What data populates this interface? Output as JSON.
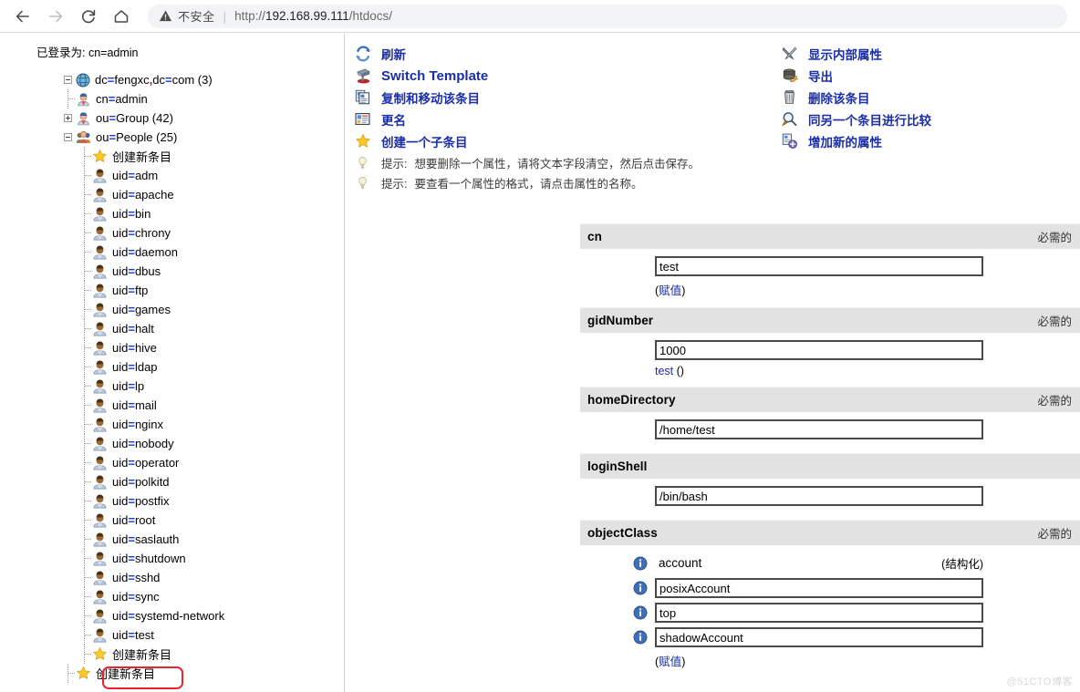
{
  "browser": {
    "back_icon": "back-arrow-icon",
    "forward_icon": "forward-arrow-icon",
    "reload_icon": "reload-icon",
    "home_icon": "home-icon",
    "warning_icon": "warning-triangle-icon",
    "insecure_label": "不安全",
    "separator": "|",
    "url_scheme": "http://",
    "url_host": "192.168.99.111",
    "url_path": "/htdocs/"
  },
  "sidebar": {
    "login_status": "已登录为: cn=admin",
    "tree": [
      {
        "label_pre": "dc",
        "label_mid": "fengxc",
        "label_post": "dc",
        "label_tail": "com",
        "count": "(3)",
        "icon": "globe-icon",
        "expander": "minus",
        "depth": 0,
        "type": "root"
      },
      {
        "label": "cn=admin",
        "icon": "user-admin-icon",
        "depth": 1,
        "type": "entry"
      },
      {
        "label": "ou=Group",
        "count": "(42)",
        "icon": "user-admin-icon",
        "expander": "plus",
        "depth": 1,
        "type": "entry"
      },
      {
        "label": "ou=People",
        "count": "(25)",
        "icon": "group-icon",
        "expander": "minus",
        "depth": 1,
        "type": "entry"
      },
      {
        "label": "创建新条目",
        "icon": "star-icon",
        "depth": 2,
        "type": "new"
      },
      {
        "label": "uid=adm",
        "icon": "person-icon",
        "depth": 2,
        "type": "entry"
      },
      {
        "label": "uid=apache",
        "icon": "person-icon",
        "depth": 2,
        "type": "entry"
      },
      {
        "label": "uid=bin",
        "icon": "person-icon",
        "depth": 2,
        "type": "entry"
      },
      {
        "label": "uid=chrony",
        "icon": "person-icon",
        "depth": 2,
        "type": "entry"
      },
      {
        "label": "uid=daemon",
        "icon": "person-icon",
        "depth": 2,
        "type": "entry"
      },
      {
        "label": "uid=dbus",
        "icon": "person-icon",
        "depth": 2,
        "type": "entry"
      },
      {
        "label": "uid=ftp",
        "icon": "person-icon",
        "depth": 2,
        "type": "entry"
      },
      {
        "label": "uid=games",
        "icon": "person-icon",
        "depth": 2,
        "type": "entry"
      },
      {
        "label": "uid=halt",
        "icon": "person-icon",
        "depth": 2,
        "type": "entry"
      },
      {
        "label": "uid=hive",
        "icon": "person-icon",
        "depth": 2,
        "type": "entry"
      },
      {
        "label": "uid=ldap",
        "icon": "person-icon",
        "depth": 2,
        "type": "entry"
      },
      {
        "label": "uid=lp",
        "icon": "person-icon",
        "depth": 2,
        "type": "entry"
      },
      {
        "label": "uid=mail",
        "icon": "person-icon",
        "depth": 2,
        "type": "entry"
      },
      {
        "label": "uid=nginx",
        "icon": "person-icon",
        "depth": 2,
        "type": "entry"
      },
      {
        "label": "uid=nobody",
        "icon": "person-icon",
        "depth": 2,
        "type": "entry"
      },
      {
        "label": "uid=operator",
        "icon": "person-icon",
        "depth": 2,
        "type": "entry"
      },
      {
        "label": "uid=polkitd",
        "icon": "person-icon",
        "depth": 2,
        "type": "entry"
      },
      {
        "label": "uid=postfix",
        "icon": "person-icon",
        "depth": 2,
        "type": "entry"
      },
      {
        "label": "uid=root",
        "icon": "person-icon",
        "depth": 2,
        "type": "entry"
      },
      {
        "label": "uid=saslauth",
        "icon": "person-icon",
        "depth": 2,
        "type": "entry"
      },
      {
        "label": "uid=shutdown",
        "icon": "person-icon",
        "depth": 2,
        "type": "entry"
      },
      {
        "label": "uid=sshd",
        "icon": "person-icon",
        "depth": 2,
        "type": "entry"
      },
      {
        "label": "uid=sync",
        "icon": "person-icon",
        "depth": 2,
        "type": "entry"
      },
      {
        "label": "uid=systemd-network",
        "icon": "person-icon",
        "depth": 2,
        "type": "entry"
      },
      {
        "label": "uid=test",
        "icon": "person-icon",
        "depth": 2,
        "type": "entry",
        "selected": true
      },
      {
        "label": "创建新条目",
        "icon": "star-icon",
        "depth": 2,
        "type": "new"
      },
      {
        "label": "创建新条目",
        "icon": "star-icon",
        "depth": 1,
        "type": "new"
      }
    ],
    "highlight_color": "#e8252a"
  },
  "toolbar": {
    "left": [
      {
        "label": "刷新",
        "icon": "refresh-icon"
      },
      {
        "label": "Switch Template",
        "icon": "template-icon",
        "big": true
      },
      {
        "label": "复制和移动该条目",
        "icon": "copy-icon"
      },
      {
        "label": "更名",
        "icon": "rename-icon"
      },
      {
        "label": "创建一个子条目",
        "icon": "star-icon"
      }
    ],
    "right": [
      {
        "label": "显示内部属性",
        "icon": "tools-icon"
      },
      {
        "label": "导出",
        "icon": "export-icon"
      },
      {
        "label": "删除该条目",
        "icon": "trash-icon"
      },
      {
        "label": "同另一个条目进行比较",
        "icon": "compare-magnifier-icon"
      },
      {
        "label": "增加新的属性",
        "icon": "add-attribute-icon"
      }
    ],
    "hints": [
      {
        "icon": "lightbulb-icon",
        "key": "提示:",
        "text": "想要删除一个属性，请将文本字段清空，然后点击保存。"
      },
      {
        "icon": "lightbulb-icon",
        "key": "提示:",
        "text": "要查看一个属性的格式，请点击属性的名称。"
      }
    ],
    "link_color": "#1a2ea8"
  },
  "attributes": [
    {
      "name": "cn",
      "required_label": "必需的",
      "values": [
        {
          "kind": "input",
          "value": "test"
        }
      ],
      "sub": {
        "open": "(",
        "link": "赋值",
        "close": ")"
      }
    },
    {
      "name": "gidNumber",
      "required_label": "必需的",
      "values": [
        {
          "kind": "input",
          "value": "1000"
        }
      ],
      "sub2": {
        "link": "test",
        "after": "()"
      }
    },
    {
      "name": "homeDirectory",
      "required_label": "必需的",
      "values": [
        {
          "kind": "input",
          "value": "/home/test"
        }
      ]
    },
    {
      "name": "loginShell",
      "required_label": "",
      "values": [
        {
          "kind": "input",
          "value": "/bin/bash"
        }
      ]
    },
    {
      "name": "objectClass",
      "required_label": "必需的",
      "values": [
        {
          "kind": "static",
          "value": "account",
          "note": "(结构化)",
          "icon": "info-icon"
        },
        {
          "kind": "input",
          "value": "posixAccount",
          "icon": "info-icon"
        },
        {
          "kind": "input",
          "value": "top",
          "icon": "info-icon"
        },
        {
          "kind": "input",
          "value": "shadowAccount",
          "icon": "info-icon"
        }
      ],
      "sub": {
        "open": "(",
        "link": "赋值",
        "close": ")"
      }
    }
  ],
  "watermark": "@51CTO博客"
}
